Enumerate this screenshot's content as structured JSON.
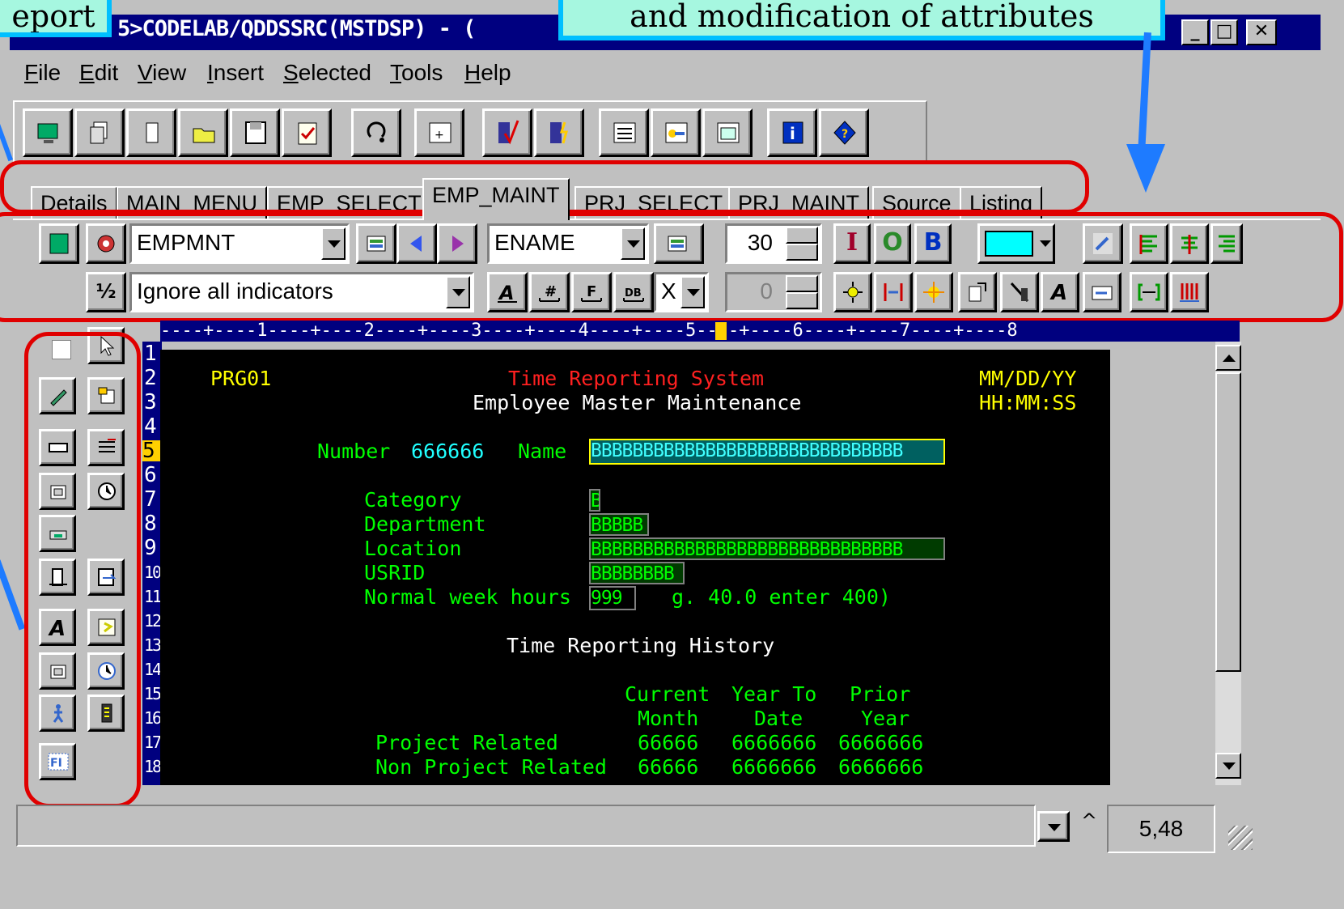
{
  "window": {
    "title": "5>CODELAB/QDDSSRC(MSTDSP) - (",
    "controls": [
      "_",
      "□",
      "✕"
    ]
  },
  "callouts": {
    "left_fragment": "eport",
    "top_attributes": "and modification of attributes"
  },
  "menu": [
    "File",
    "Edit",
    "View",
    "Insert",
    "Selected",
    "Tools",
    "Help"
  ],
  "tabs": [
    "Details",
    "MAIN_MENU",
    "EMP_SELECT",
    "EMP_MAINT",
    "PRJ_SELECT",
    "PRJ_MAINT",
    "Source",
    "Listing"
  ],
  "active_tab": "EMP_MAINT",
  "attr_toolbar": {
    "record_combo": "EMPMNT",
    "field_combo": "ENAME",
    "length_value": "30",
    "indicator_combo": "Ignore all indicators",
    "decimal_value": "0",
    "x_combo": "X",
    "io_buttons": [
      "I",
      "O",
      "B"
    ]
  },
  "ruler": "----+----1----+----2----+----3----+----4----+----5----+----6----+----7----+----8",
  "line_numbers": [
    "1",
    "2",
    "3",
    "4",
    "5",
    "6",
    "7",
    "8",
    "9",
    "10",
    "11",
    "12",
    "13",
    "14",
    "15",
    "16",
    "17",
    "18"
  ],
  "current_line": "5",
  "screen": {
    "program": "PRG01",
    "system_title": "Time Reporting System",
    "subtitle": "Employee Master Maintenance",
    "date_fmt": "MM/DD/YY",
    "time_fmt": "HH:MM:SS",
    "number_label": "Number",
    "number_value": "666666",
    "name_label": "Name",
    "name_field": "BBBBBBBBBBBBBBBBBBBBBBBBBBBBBB",
    "category_label": "Category",
    "category_field": "B",
    "department_label": "Department",
    "department_field": "BBBBB",
    "location_label": "Location",
    "location_field": "BBBBBBBBBBBBBBBBBBBBBBBBBBBBBB",
    "usrid_label": "USRID",
    "usrid_field": "BBBBBBBB",
    "hours_label": "Normal week hours",
    "hours_field": "999",
    "hours_hint": "g. 40.0 enter 400)",
    "history_title": "Time Reporting History",
    "col1a": "Current",
    "col1b": "Month",
    "col2a": "Year To",
    "col2b": "Date",
    "col3a": "Prior",
    "col3b": "Year",
    "row1_label": "Project Related",
    "row1_v1": "66666",
    "row1_v2": "6666666",
    "row1_v3": "6666666",
    "row2_label": "Non Project Related",
    "row2_v1": "66666",
    "row2_v2": "6666666",
    "row2_v3": "6666666"
  },
  "status": {
    "caret": "^",
    "position": "5,48"
  },
  "colors": {
    "title_bar": "#000080",
    "highlight_red": "#e00000",
    "callout_fill": "#a6f7e0",
    "callout_border": "#00bfff",
    "arrow_blue": "#1e7bff"
  }
}
